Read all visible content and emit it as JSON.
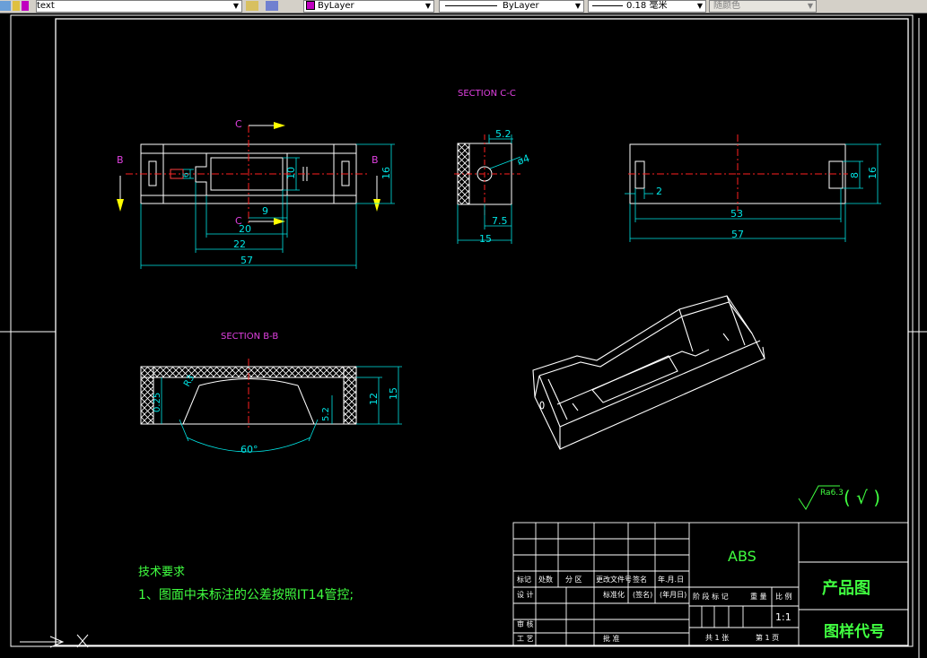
{
  "toolbar": {
    "text_style": "text",
    "color_layer": "ByLayer",
    "linetype_layer": "ByLayer",
    "lineweight": "0.18 毫米",
    "plot_style": "随颜色"
  },
  "drawing": {
    "colors": {
      "background": "#000000",
      "frame": "#ffffff",
      "dimension": "#00e5e5",
      "section_label": "#e040e0",
      "center_line": "#ff2020",
      "arrow": "#ffff00",
      "title_green": "#40ff40"
    },
    "top_view": {
      "label_c_top": "C",
      "label_c_bottom": "C",
      "label_b_left": "B",
      "label_b_right": "B",
      "dims": {
        "d57": "57",
        "d22": "22",
        "d20": "20",
        "d9": "9",
        "d16": "16",
        "d10": "10",
        "d6": "6"
      }
    },
    "section_cc": {
      "title": "SECTION C-C",
      "dims": {
        "d5_2": "5.2",
        "d4": "ø4",
        "d7_5": "7.5",
        "d15": "15"
      }
    },
    "side_view": {
      "dims": {
        "d57": "57",
        "d53": "53",
        "d2": "2",
        "d8": "8",
        "d16": "16"
      }
    },
    "section_bb": {
      "title": "SECTION B-B",
      "dims": {
        "d0_25": "0.25",
        "dR3": "R3",
        "d5_2": "5.2",
        "d12": "12",
        "d15": "15",
        "d60": "60°"
      }
    },
    "roughness": {
      "value": "Ra6.3",
      "mark": "( √ )"
    },
    "notes": {
      "heading": "技术要求",
      "line1": "1、图面中未标注的公差按照IT14管控;"
    },
    "title_block": {
      "material": "ABS",
      "product": "产品图",
      "code": "图样代号",
      "scale": "1:1",
      "row_labels": [
        "标记",
        "处数",
        "分 区",
        "更改文件号",
        "签名",
        "年.月.日"
      ],
      "design": "设 计",
      "standardize": "标准化",
      "sign": "(签名)",
      "date": "(年月日)",
      "review": "审 核",
      "process": "工 艺",
      "approve": "批 准",
      "stage_headers": [
        "阶 段 标 记",
        "重 量",
        "比 例"
      ],
      "sheet_total": "共 1 张",
      "sheet_no": "第 1 页"
    }
  }
}
